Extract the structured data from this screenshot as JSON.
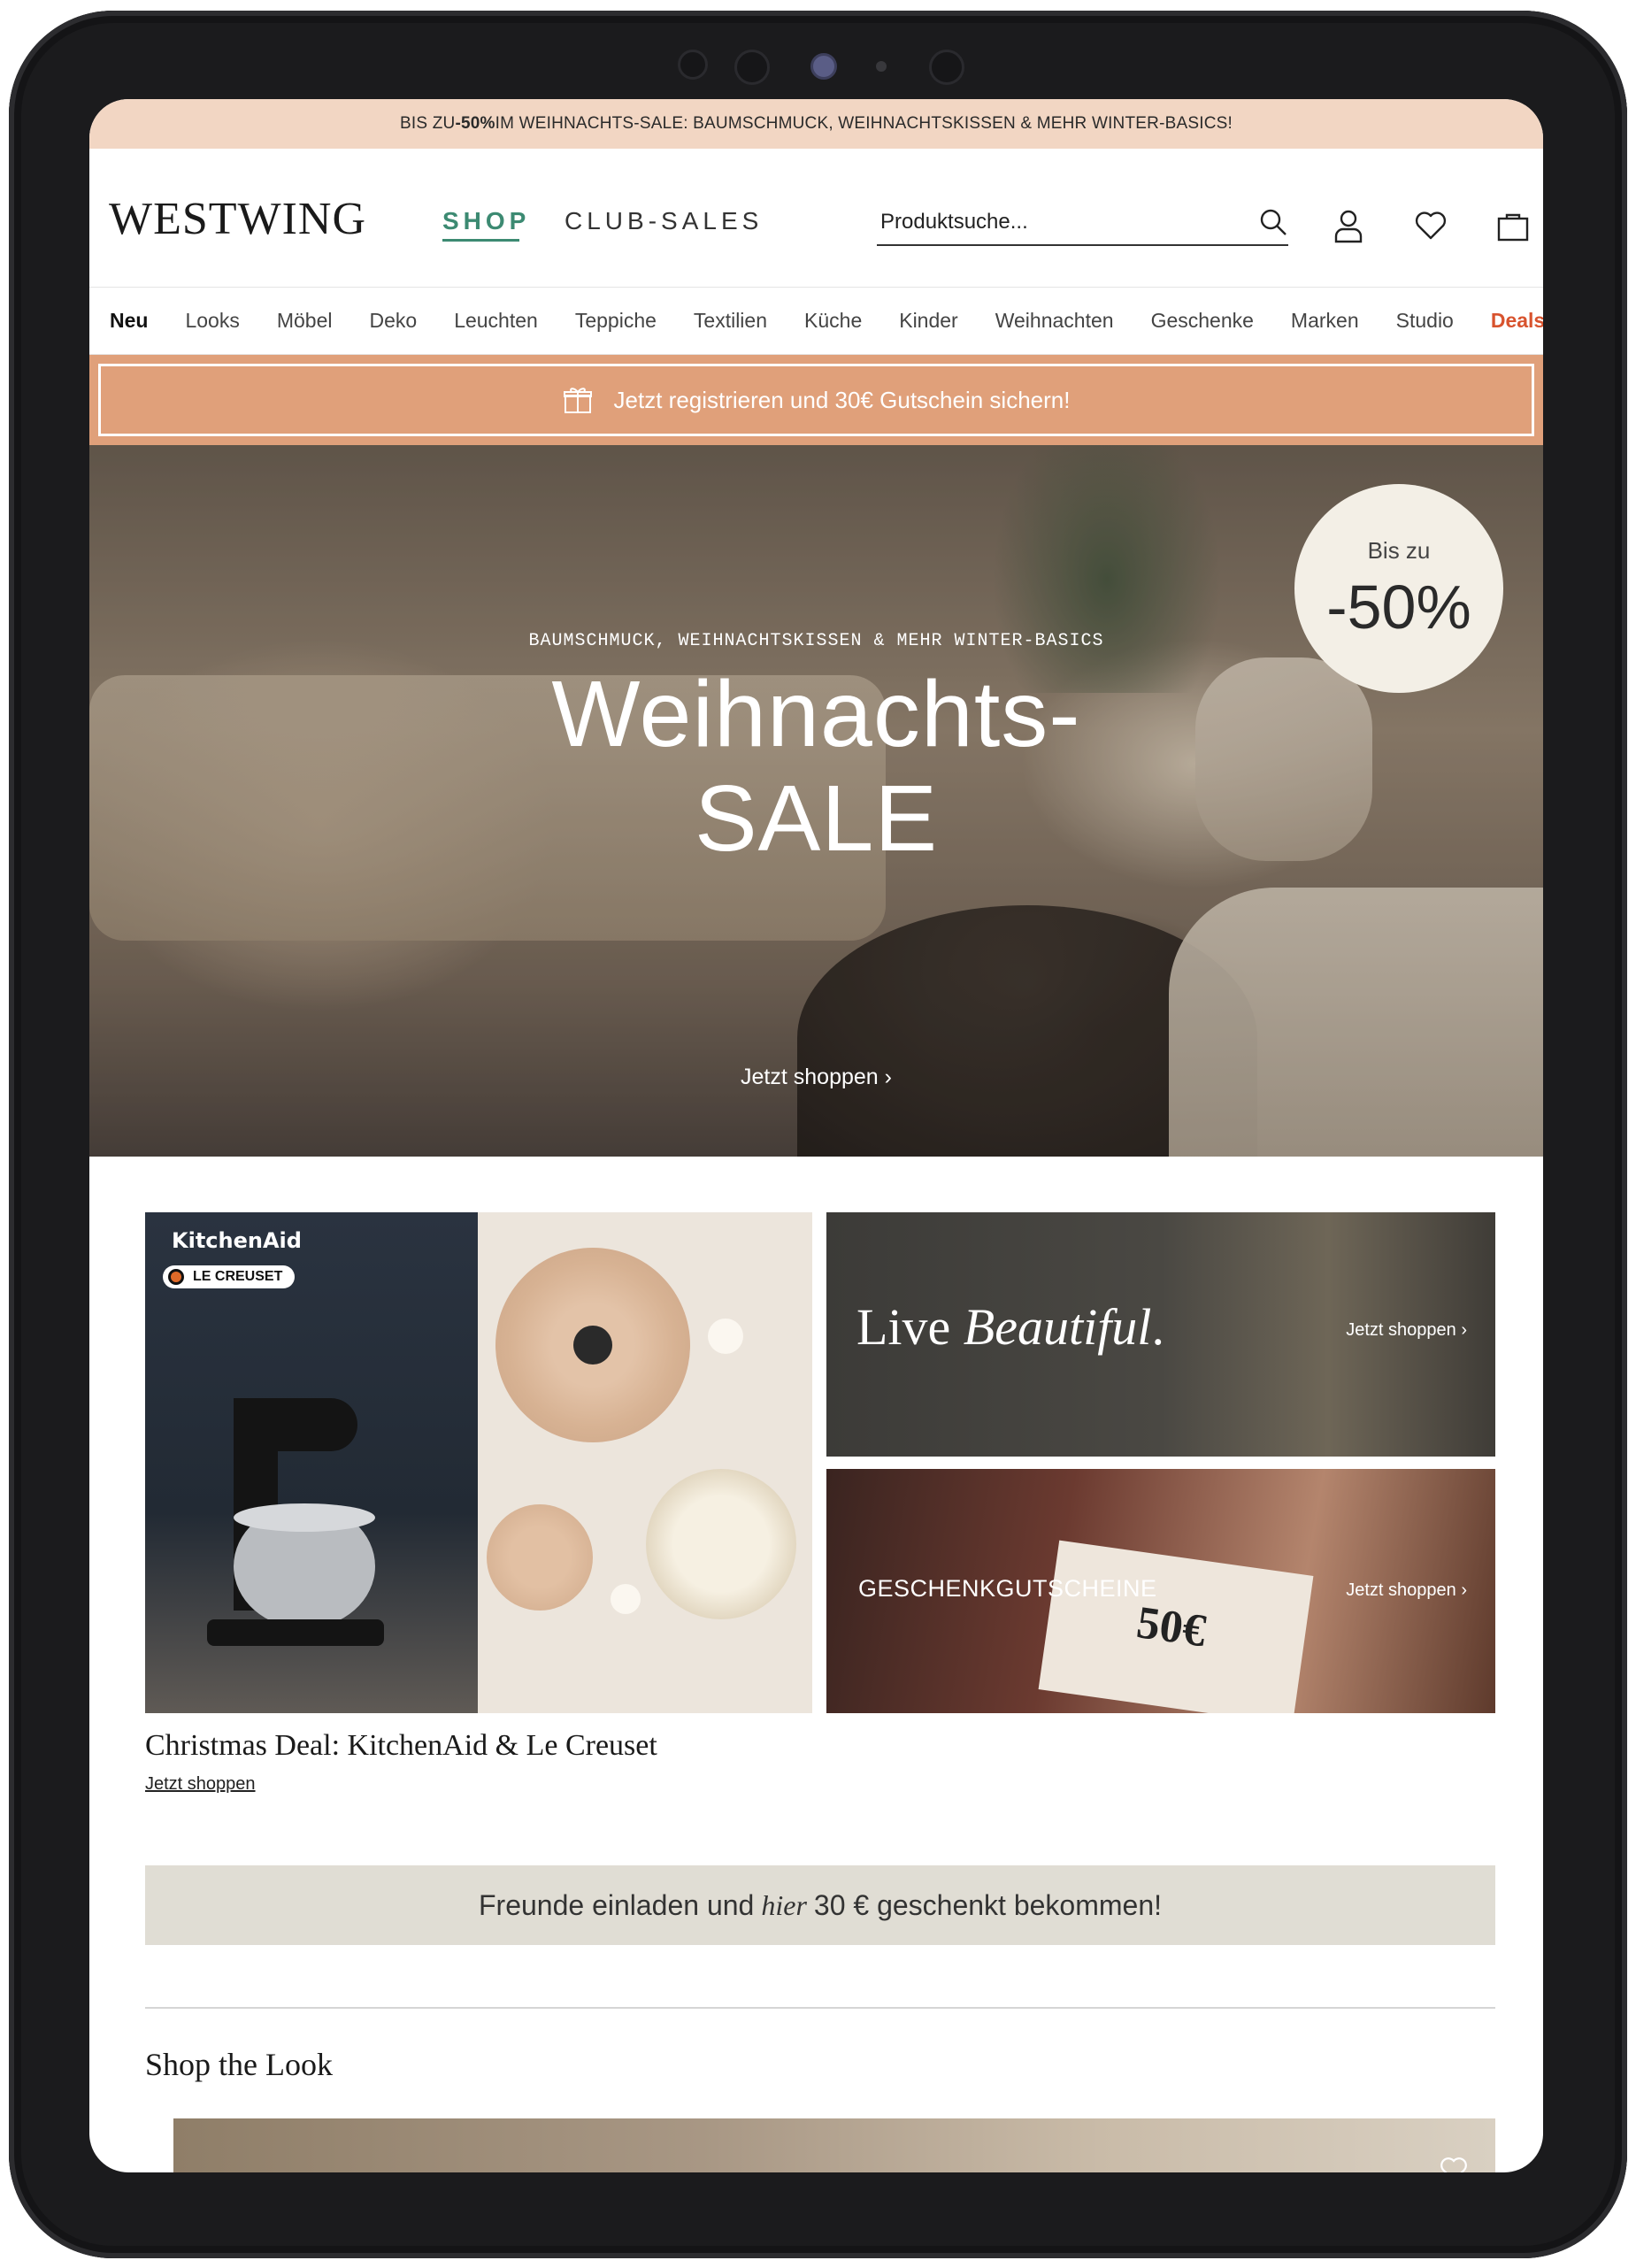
{
  "promo": {
    "prefix": "BIS ZU ",
    "bold": "-50%",
    "suffix": " IM WEIHNACHTS-SALE: BAUMSCHMUCK, WEIHNACHTSKISSEN & MEHR WINTER-BASICS!"
  },
  "header": {
    "logo": "WESTWING",
    "nav_shop": "SHOP",
    "nav_club": "CLUB-SALES",
    "search_placeholder": "Produktsuche..."
  },
  "categories": [
    "Neu",
    "Looks",
    "Möbel",
    "Deko",
    "Leuchten",
    "Teppiche",
    "Textilien",
    "Küche",
    "Kinder",
    "Weihnachten",
    "Geschenke",
    "Marken",
    "Studio",
    "Deals"
  ],
  "register_banner": "Jetzt registrieren und 30€ Gutschein sichern!",
  "hero": {
    "subtitle": "BAUMSCHMUCK, WEIHNACHTSKISSEN & MEHR WINTER-BASICS",
    "title_line1": "Weihnachts-",
    "title_line2": "SALE",
    "cta": "Jetzt shoppen ›",
    "badge_top": "Bis zu",
    "badge_value": "-50%"
  },
  "tiles": {
    "big": {
      "brand1": "KitchenAid",
      "brand2": "LE CREUSET"
    },
    "live": {
      "word1": "Live",
      "word2": "Beautiful",
      "dot": ".",
      "cta": "Jetzt shoppen ›"
    },
    "gift": {
      "title": "GESCHENKGUTSCHEINE",
      "voucher": "50€",
      "cta": "Jetzt shoppen ›"
    }
  },
  "deal": {
    "title": "Christmas Deal: KitchenAid & Le Creuset",
    "link": "Jetzt shoppen"
  },
  "refer": {
    "before": "Freunde einladen und",
    "hier": "hier",
    "after": "30 € geschenkt bekommen!"
  },
  "shop_the_look": "Shop the Look",
  "colors": {
    "promo_bg": "#f2d6c3",
    "accent_green": "#3c8a72",
    "register_bg": "#e0a07a",
    "deals_red": "#d8532e",
    "refer_bg": "#e0ddd4"
  }
}
